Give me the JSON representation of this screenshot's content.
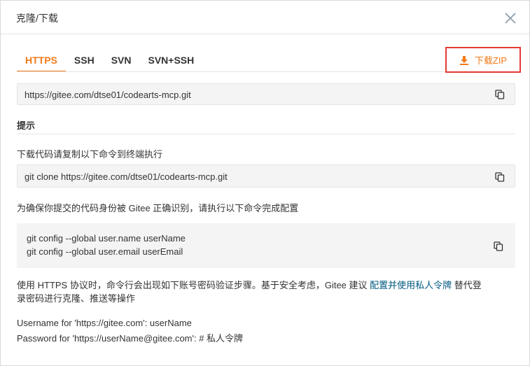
{
  "dialog": {
    "title": "克隆/下载"
  },
  "tabs": [
    {
      "label": "HTTPS",
      "active": true
    },
    {
      "label": "SSH",
      "active": false
    },
    {
      "label": "SVN",
      "active": false
    },
    {
      "label": "SVN+SSH",
      "active": false
    }
  ],
  "zip_button": {
    "label": "下载ZIP",
    "icon": "download-icon"
  },
  "repo_url": "https://gitee.com/dtse01/codearts-mcp.git",
  "tips": {
    "title": "提示",
    "clone_hint": "下载代码请复制以下命令到终端执行",
    "clone_command": "git clone https://gitee.com/dtse01/codearts-mcp.git",
    "identity_hint": "为确保你提交的代码身份被 Gitee 正确识别，请执行以下命令完成配置",
    "config_line1": "git config --global user.name userName",
    "config_line2": "git config --global user.email userEmail",
    "https_note_before": "使用 HTTPS 协议时，命令行会出现如下账号密码验证步骤。基于安全考虑，Gitee 建议 ",
    "https_note_link": "配置并使用私人令牌",
    "https_note_after_line1": " 替代登",
    "https_note_line2": "录密码进行克隆、推送等操作",
    "username_line": "Username for 'https://gitee.com': userName",
    "password_line": "Password for 'https://userName@gitee.com': # 私人令牌"
  },
  "colors": {
    "accent": "#f27a1a",
    "highlight_border": "#e53935",
    "link": "#005980"
  }
}
